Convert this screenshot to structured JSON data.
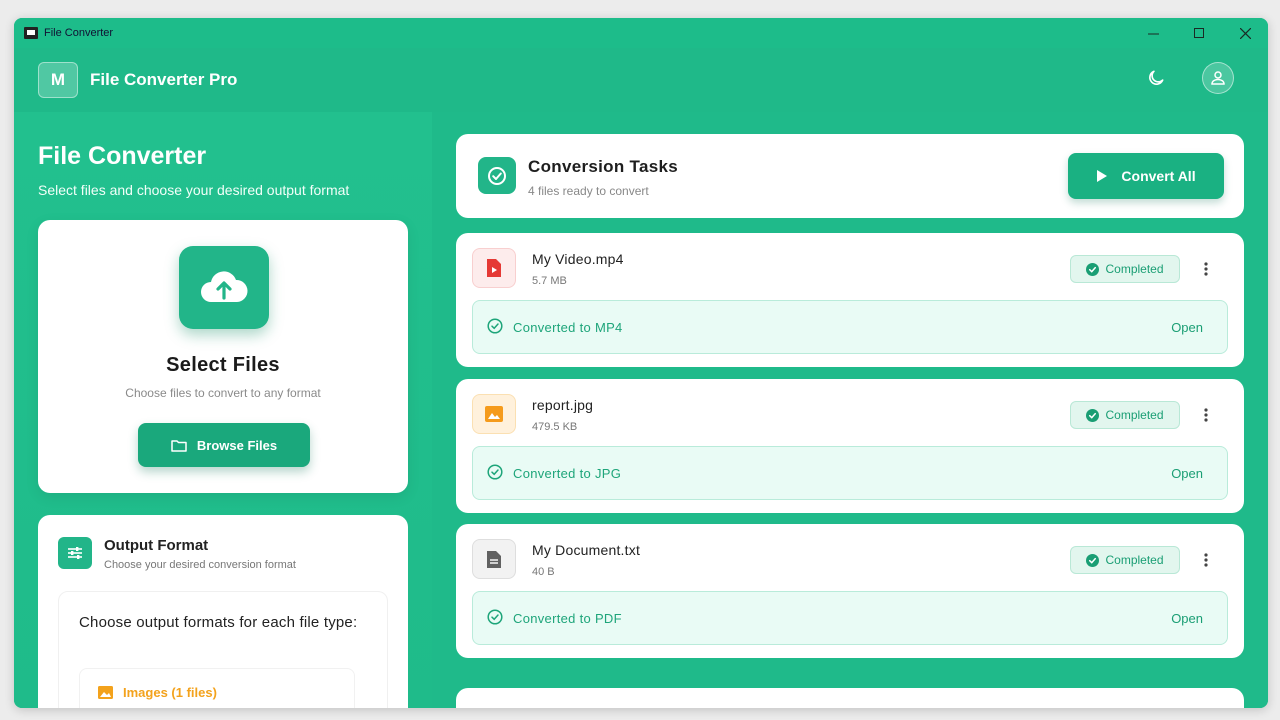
{
  "window": {
    "title": "File Converter",
    "controls": [
      "minimize",
      "maximize",
      "close"
    ]
  },
  "header": {
    "logo_letter": "M",
    "brand": "File Converter Pro",
    "icons": [
      "moon-icon",
      "user-icon"
    ]
  },
  "left": {
    "title": "File Converter",
    "subtitle": "Select files and choose your desired output format",
    "select_card": {
      "title": "Select Files",
      "subtitle": "Choose files to convert to any format",
      "browse_label": "Browse Files"
    },
    "output_format": {
      "title": "Output Format",
      "subtitle": "Choose your desired conversion format",
      "question": "Choose output formats for each file type:",
      "groups": [
        {
          "label": "Images (1 files)",
          "color": "#f3a21c"
        }
      ]
    }
  },
  "tasks": {
    "title": "Conversion Tasks",
    "subtitle": "4 files ready to convert",
    "convert_all_label": "Convert All",
    "files": [
      {
        "name": "My Video.mp4",
        "size": "5.7 MB",
        "status": "Completed",
        "result": "Converted to MP4",
        "action": "Open",
        "icon": "video-file-icon",
        "icon_color": "#e53935",
        "icon_bg": "#fdecec"
      },
      {
        "name": "report.jpg",
        "size": "479.5 KB",
        "status": "Completed",
        "result": "Converted to JPG",
        "action": "Open",
        "icon": "image-file-icon",
        "icon_color": "#f59b1c",
        "icon_bg": "#fff1dc"
      },
      {
        "name": "My Document.txt",
        "size": "40 B",
        "status": "Completed",
        "result": "Converted to PDF",
        "action": "Open",
        "icon": "document-file-icon",
        "icon_color": "#616161",
        "icon_bg": "#f2f2f2"
      }
    ]
  },
  "colors": {
    "brand": "#1fb989",
    "accent": "#1aa87c",
    "success_text": "#1a9e74"
  }
}
